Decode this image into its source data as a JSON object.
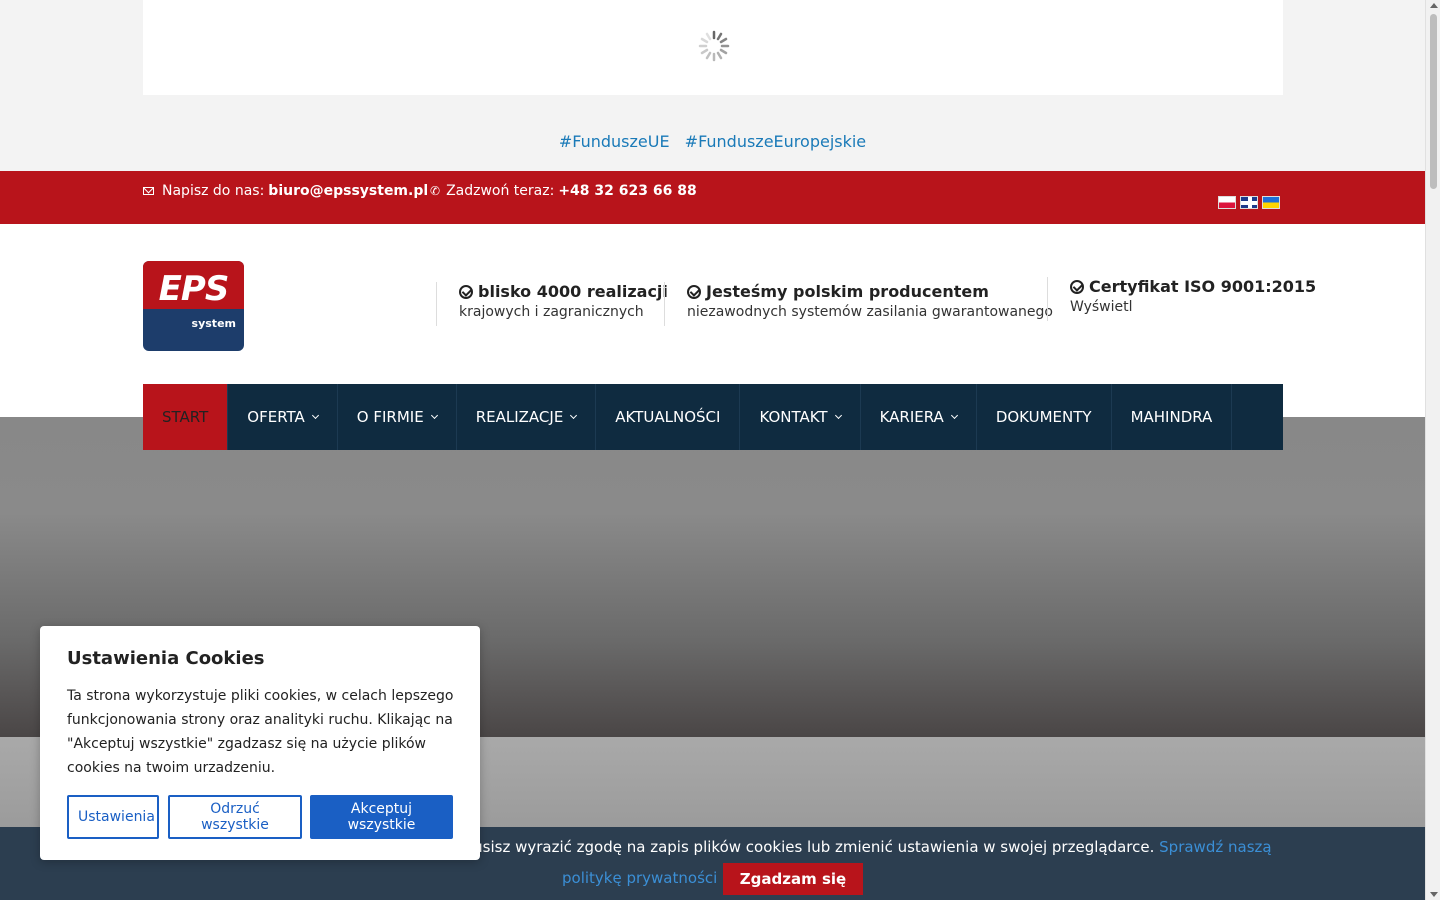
{
  "hashtags": [
    "#FunduszeUE",
    "#FunduszeEuropejskie"
  ],
  "topbar": {
    "email_prefix": "Napisz do nas:",
    "email": "biuro@epssystem.pl",
    "phone_prefix": "Zadzwoń teraz:",
    "phone": "+48 32 623 66 88",
    "languages": [
      "pl",
      "en",
      "ua"
    ]
  },
  "logo": {
    "main": "EPS",
    "sub": "system"
  },
  "features": [
    {
      "title": "blisko 4000 realizacji",
      "subtitle": "krajowych i zagranicznych"
    },
    {
      "title": "Jesteśmy polskim producentem",
      "subtitle": "niezawodnych systemów zasilania gwarantowanego"
    },
    {
      "title": "Certyfikat ISO 9001:2015",
      "subtitle": "Wyświetl"
    }
  ],
  "nav": [
    {
      "label": "START",
      "dropdown": false
    },
    {
      "label": "OFERTA",
      "dropdown": true
    },
    {
      "label": "O FIRMIE",
      "dropdown": true
    },
    {
      "label": "REALIZACJE",
      "dropdown": true
    },
    {
      "label": "AKTUALNOŚCI",
      "dropdown": false
    },
    {
      "label": "KONTAKT",
      "dropdown": true
    },
    {
      "label": "KARIERA",
      "dropdown": true
    },
    {
      "label": "DOKUMENTY",
      "dropdown": false
    },
    {
      "label": "MAHINDRA",
      "dropdown": false
    }
  ],
  "cookie_bar": {
    "text": "eglądanie strony, musisz wyrazić zgodę na zapis plików cookies lub zmienić ustawienia w swojej przeglądarce.",
    "link_part1": "Sprawdź naszą",
    "link_part2": "politykę prywatności",
    "agree": "Zgadzam się"
  },
  "cookie_modal": {
    "title": "Ustawienia Cookies",
    "text": "Ta strona wykorzystuje pliki cookies, w celach lepszego funkcjonowania strony oraz analityki ruchu. Klikając na \"Akceptuj wszystkie\" zgadzasz się na użycie plików cookies na twoim urzadzeniu.",
    "settings": "Ustawienia",
    "reject": "Odrzuć wszystkie",
    "accept": "Akceptuj wszystkie"
  },
  "colors": {
    "brand_red": "#b8141b",
    "nav_dark": "#0f2b40",
    "link_blue": "#1a7ab8",
    "button_blue": "#1a5fc4"
  }
}
